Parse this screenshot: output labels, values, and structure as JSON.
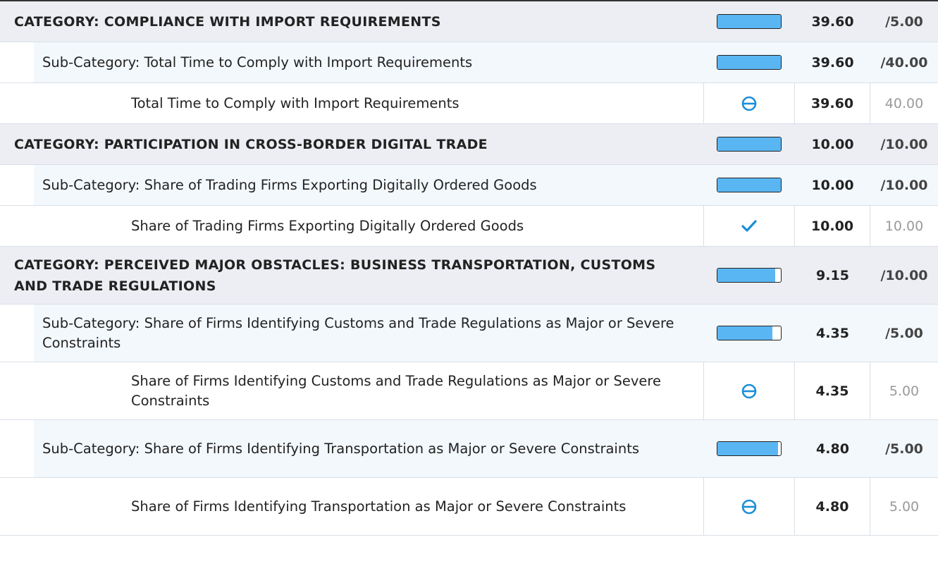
{
  "rows": [
    {
      "type": "cat",
      "label": "CATEGORY: COMPLIANCE WITH IMPORT REQUIREMENTS",
      "progress": 1.0,
      "score": "39.60",
      "max": "/5.00",
      "height": 58
    },
    {
      "type": "sub",
      "label": "Sub-Category: Total Time to Comply with Import Requirements",
      "progress": 1.0,
      "score": "39.60",
      "max": "/40.00",
      "height": 58
    },
    {
      "type": "item",
      "label": "Total Time to Comply with Import Requirements",
      "icon": "minus-circle-icon",
      "score": "39.60",
      "max": "40.00",
      "height": 58
    },
    {
      "type": "cat",
      "label": "CATEGORY: PARTICIPATION IN CROSS-BORDER DIGITAL TRADE",
      "progress": 1.0,
      "score": "10.00",
      "max": "/10.00",
      "height": 58
    },
    {
      "type": "sub",
      "label": "Sub-Category: Share of Trading Firms Exporting Digitally Ordered Goods",
      "progress": 1.0,
      "score": "10.00",
      "max": "/10.00",
      "height": 58
    },
    {
      "type": "item",
      "label": "Share of Trading Firms Exporting Digitally Ordered Goods",
      "icon": "check-icon",
      "score": "10.00",
      "max": "10.00",
      "height": 58
    },
    {
      "type": "cat",
      "label": "CATEGORY: PERCEIVED MAJOR OBSTACLES: BUSINESS TRANSPORTATION, CUSTOMS AND TRADE REGULATIONS",
      "progress": 0.915,
      "score": "9.15",
      "max": "/10.00",
      "height": 82
    },
    {
      "type": "sub",
      "label": "Sub-Category: Share of Firms Identifying Customs and Trade Regulations as Major or Severe Constraints",
      "progress": 0.87,
      "score": "4.35",
      "max": "/5.00",
      "height": 82
    },
    {
      "type": "item",
      "label": "Share of Firms Identifying Customs and Trade Regulations as Major or Severe Constraints",
      "icon": "minus-circle-icon",
      "score": "4.35",
      "max": "5.00",
      "height": 82
    },
    {
      "type": "sub",
      "label": "Sub-Category: Share of Firms Identifying Transportation as Major or Severe Constraints",
      "progress": 0.96,
      "score": "4.80",
      "max": "/5.00",
      "height": 82
    },
    {
      "type": "item",
      "label": "Share of Firms Identifying Transportation as Major or Severe Constraints",
      "icon": "minus-circle-icon",
      "score": "4.80",
      "max": "5.00",
      "height": 82
    }
  ],
  "colors": {
    "bar_fill": "#5ab6f3",
    "icon": "#1a8ed8",
    "category_bg": "#eceef4",
    "subcategory_bg": "#f3f8fd"
  }
}
